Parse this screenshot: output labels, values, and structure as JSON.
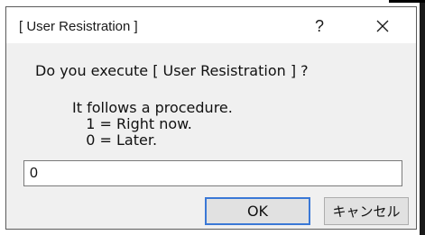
{
  "dialog": {
    "title": "[ User Resistration ]",
    "help_label": "?",
    "close_icon": "close-icon",
    "message": "Do you execute [ User Resistration ] ?",
    "procedure_lines": [
      "It follows a procedure.",
      "   1 = Right now.",
      "   0 = Later."
    ],
    "input_value": "0",
    "input_placeholder": "",
    "ok_label": "OK",
    "cancel_label": "キャンセル"
  },
  "colors": {
    "dialog_background": "#f0f0f0",
    "titlebar_background": "#ffffff",
    "default_button_border": "#3a78d6",
    "button_background": "#e1e1e1"
  }
}
